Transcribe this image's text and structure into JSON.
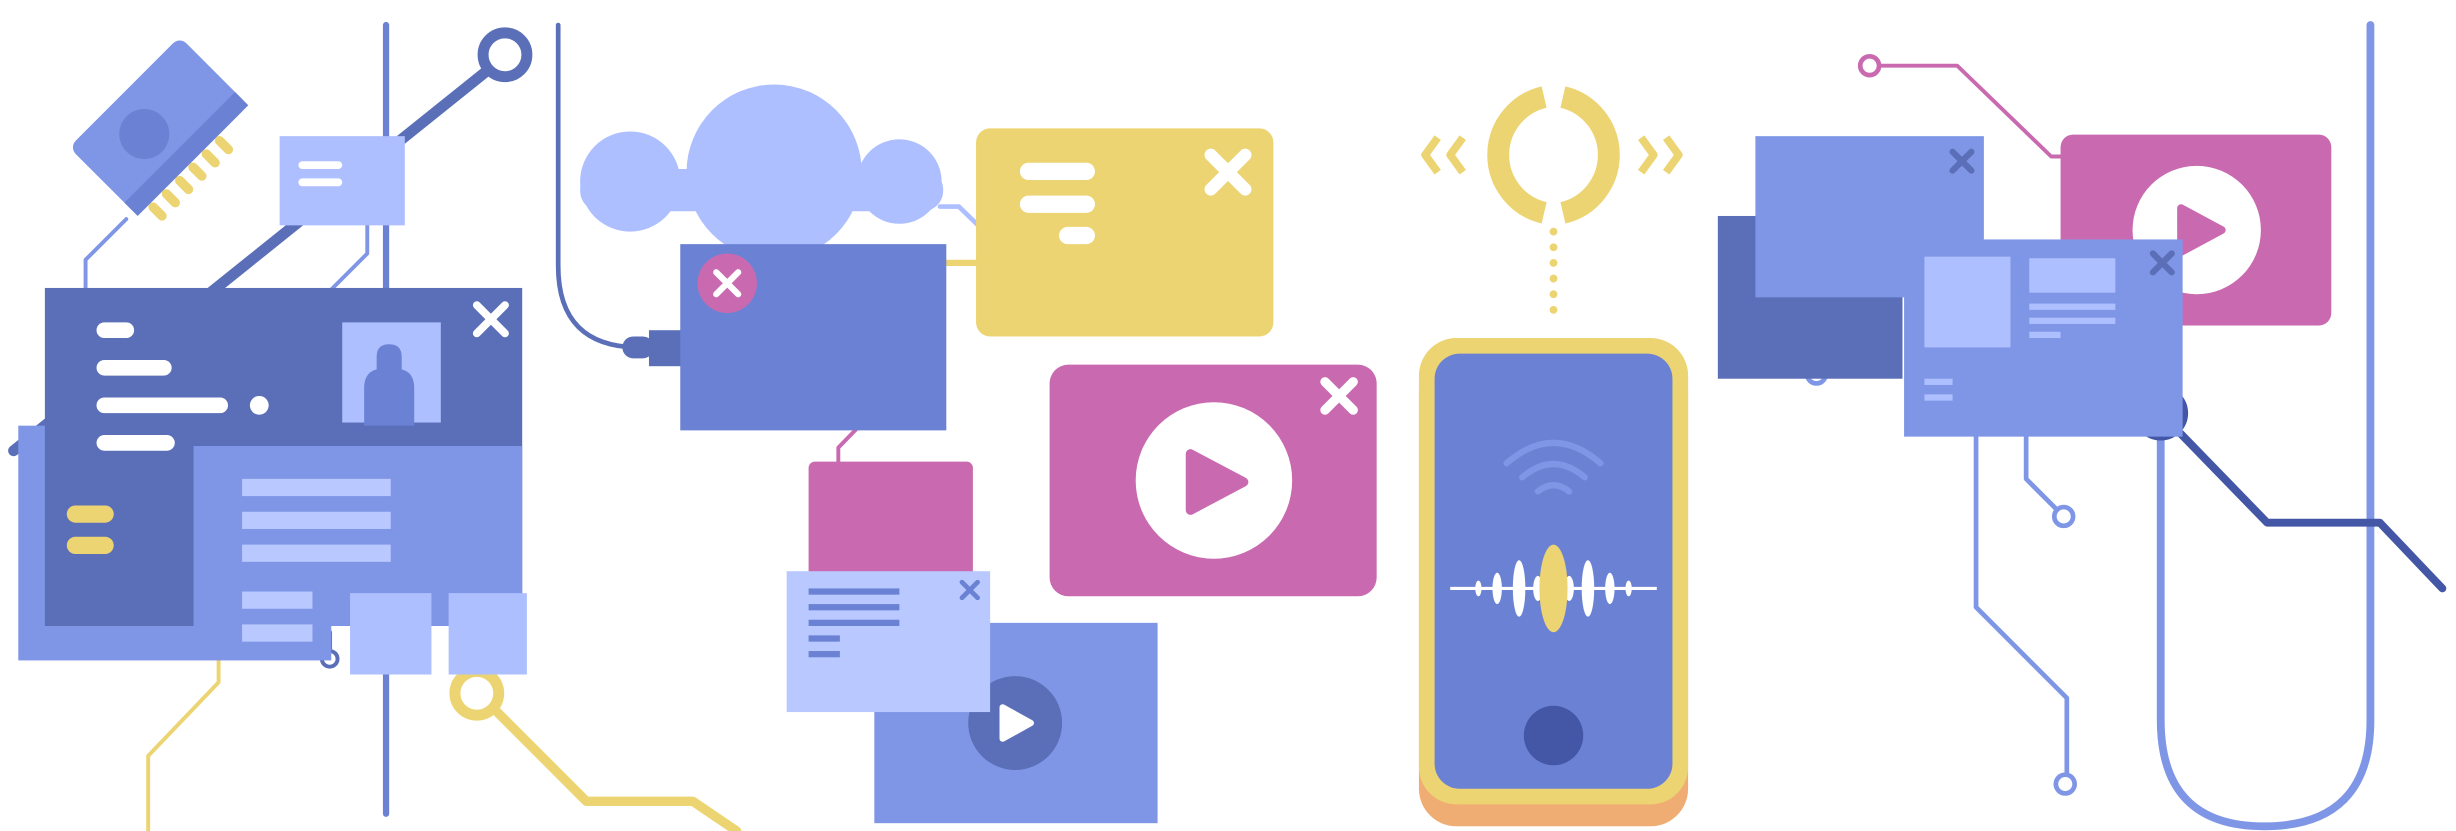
{
  "palette": {
    "navy": "#5b6fb8",
    "blue": "#6b82d4",
    "periwinkle": "#7f96e6",
    "light_blue": "#aebfff",
    "pale_blue": "#b9c8ff",
    "yellow": "#edd472",
    "magenta": "#c96ab1",
    "orange": "#f0ad73",
    "white": "#ffffff",
    "dark_navy": "#4457a7"
  },
  "icons": {
    "close": "close-icon",
    "play": "play-icon",
    "user": "user-avatar-icon",
    "wifi": "wifi-signal-icon",
    "sound_wave": "sound-wave-icon",
    "cloud": "cloud-icon",
    "chip": "memory-chip-icon",
    "sync": "sync-arrows-icon"
  }
}
